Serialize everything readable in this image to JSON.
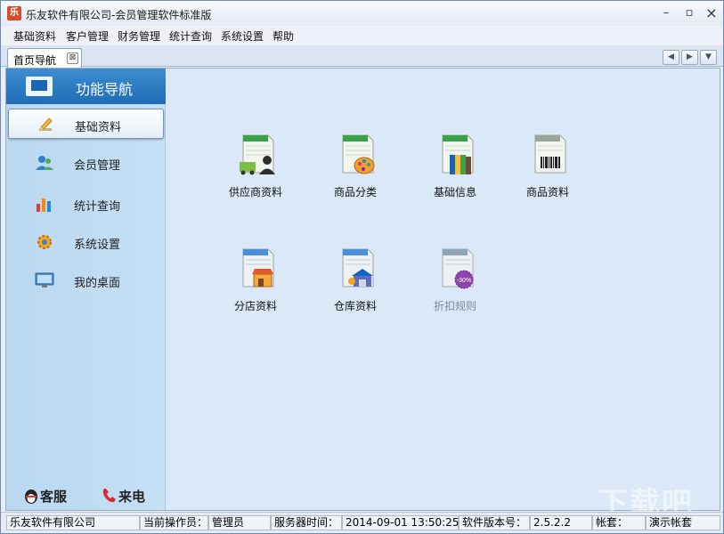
{
  "window": {
    "title": "乐友软件有限公司-会员管理软件标准版",
    "app_icon_glyph": "乐"
  },
  "window_controls": {
    "minimize": "–",
    "maximize": "▫",
    "close": "×"
  },
  "menu": [
    "基础资料",
    "客户管理",
    "财务管理",
    "统计查询",
    "系统设置",
    "帮助"
  ],
  "tab": {
    "label": "首页导航",
    "close": "⊠"
  },
  "tab_nav": {
    "prev": "◀",
    "next": "▶",
    "down": "▼"
  },
  "sidebar": {
    "header": "功能导航",
    "items": [
      {
        "label": "基础资料",
        "icon": "pencil-icon",
        "active": true
      },
      {
        "label": "会员管理",
        "icon": "members-icon",
        "active": false
      },
      {
        "label": "统计查询",
        "icon": "bar-chart-icon",
        "active": false
      },
      {
        "label": "系统设置",
        "icon": "gear-icon",
        "active": false
      },
      {
        "label": "我的桌面",
        "icon": "monitor-icon",
        "active": false
      }
    ],
    "footer": {
      "service": "客服",
      "call": "来电"
    }
  },
  "grid": [
    {
      "label": "供应商资料",
      "icon": "supplier-icon"
    },
    {
      "label": "商品分类",
      "icon": "category-icon"
    },
    {
      "label": "基础信息",
      "icon": "base-info-icon"
    },
    {
      "label": "商品资料",
      "icon": "product-icon"
    },
    {
      "label": "分店资料",
      "icon": "branch-icon"
    },
    {
      "label": "仓库资料",
      "icon": "warehouse-icon"
    },
    {
      "label": "折扣规则",
      "icon": "discount-icon",
      "disabled": true,
      "badge": "-30%"
    }
  ],
  "status": {
    "company": "乐友软件有限公司",
    "operator_label": "当前操作员：",
    "operator": "管理员",
    "server_time_label": "服务器时间：",
    "server_time": "2014-09-01 13:50:25",
    "version_label": "软件版本号：",
    "version": "2.5.2.2",
    "account_label": "帐套：",
    "account": "演示帐套"
  },
  "watermark": "下载吧",
  "colors": {
    "accent": "#1e6cb6",
    "sidebar": "#c6e0f4",
    "content_bg": "#dae8f8"
  }
}
